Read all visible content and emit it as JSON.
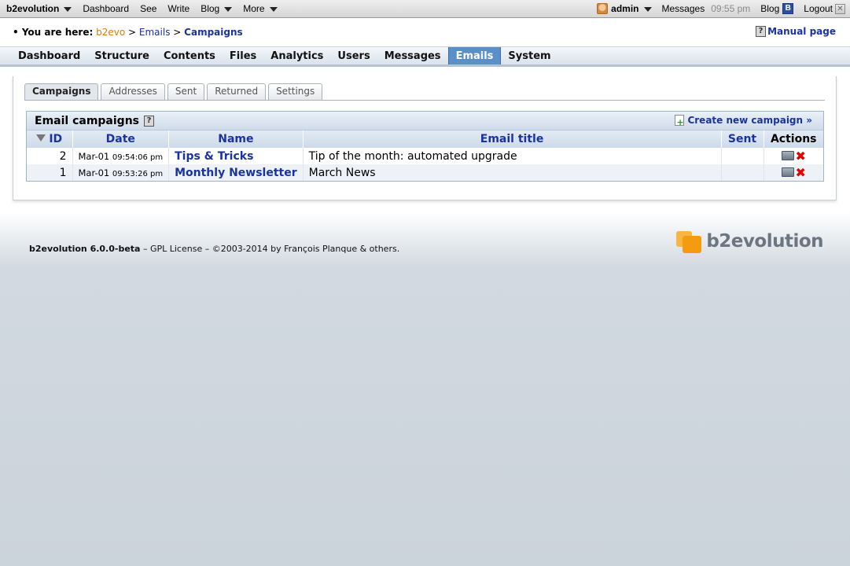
{
  "evobar": {
    "brand": "b2evolution",
    "left_items": [
      "Dashboard",
      "See",
      "Write",
      "Blog",
      "More"
    ],
    "user": "admin",
    "messages": "Messages",
    "time": "09:55 pm",
    "blog": "Blog",
    "blog_icon_letter": "B",
    "logout": "Logout"
  },
  "breadcrumb": {
    "label": "• You are here:",
    "home": "b2evo",
    "sep": ">",
    "level1": "Emails",
    "current": "Campaigns"
  },
  "manual_link": "Manual page",
  "main_menu": [
    "Dashboard",
    "Structure",
    "Contents",
    "Files",
    "Analytics",
    "Users",
    "Messages",
    "Emails",
    "System"
  ],
  "active_menu": "Emails",
  "tabs": [
    "Campaigns",
    "Addresses",
    "Sent",
    "Returned",
    "Settings"
  ],
  "active_tab": "Campaigns",
  "results": {
    "title": "Email campaigns",
    "create_label": "Create new campaign »",
    "columns": {
      "id": "ID",
      "date": "Date",
      "name": "Name",
      "email_title": "Email title",
      "sent": "Sent",
      "actions": "Actions"
    },
    "rows": [
      {
        "id": "2",
        "date": "Mar-01",
        "time": "09:54:06 pm",
        "name": "Tips & Tricks",
        "email_title": "Tip of the month: automated upgrade",
        "sent": ""
      },
      {
        "id": "1",
        "date": "Mar-01",
        "time": "09:53:26 pm",
        "name": "Monthly Newsletter",
        "email_title": "March News",
        "sent": ""
      }
    ]
  },
  "footer": {
    "version": "b2evolution 6.0.0-beta",
    "rest": " – GPL License – ©2003-2014 by François Planque & others."
  },
  "logo_text": "b2evolution",
  "icons": {
    "evobar_dropdown": "chevron-down-icon",
    "user": "user-avatar-icon",
    "blog": "blog-icon",
    "logout": "logout-icon",
    "help": "help-icon",
    "create": "new-document-icon",
    "sort": "sort-desc-icon",
    "edit": "edit-icon",
    "delete": "delete-icon"
  },
  "colors": {
    "link": "#1a33a0",
    "active_menu": "#5b8fc8",
    "home_link": "#e07b00",
    "delete": "#e00000",
    "logo_orange": "#f39c12"
  }
}
